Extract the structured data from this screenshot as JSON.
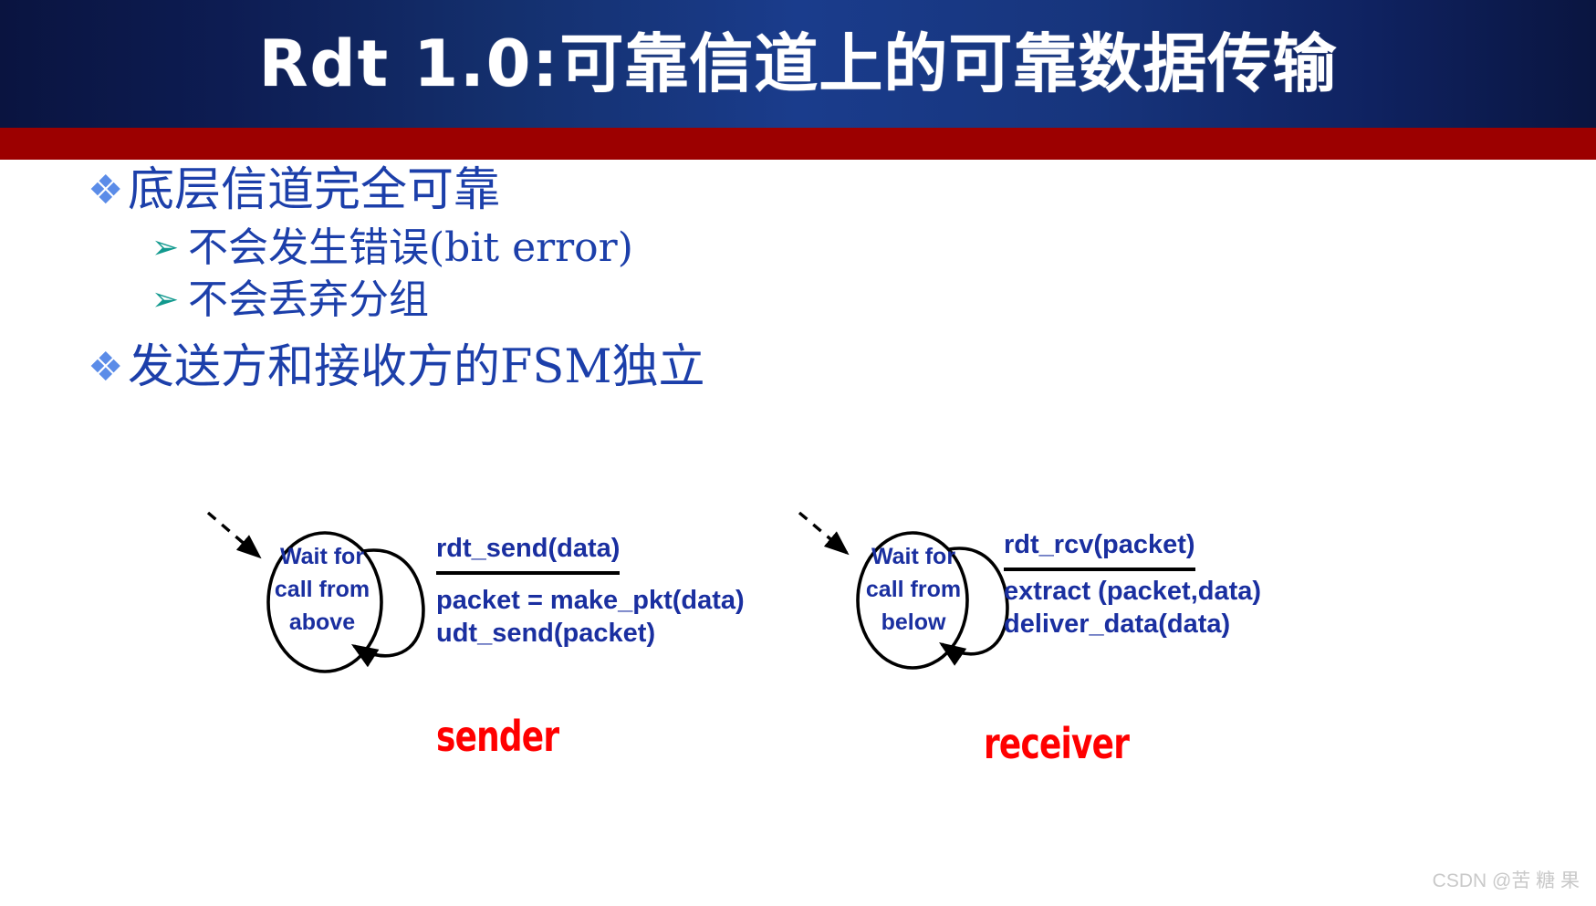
{
  "slide": {
    "title": {
      "latin": "Rdt 1.0:",
      "chinese": "可靠信道上的可靠数据传输",
      "full": "Rdt 1.0: 可靠信道上的可靠数据传输"
    },
    "colors": {
      "banner_navy": "#14306e",
      "banner_rule_red": "#9c0000",
      "bullet_text_blue": "#1c3faa",
      "bullet_marker_blue": "#5b8ce8",
      "sub_marker_teal": "#11998e",
      "fsm_text_blue": "#1a2fa0",
      "role_label_red": "#ff0000",
      "watermark_gray": "#c9c9c9"
    },
    "bullets": [
      {
        "marker": "❖",
        "label": "底层信道完全可靠",
        "level": 1
      },
      {
        "marker": "➢",
        "label": "不会发生错误(bit error)",
        "level": 2
      },
      {
        "marker": "➢",
        "label": "不会丢弃分组",
        "level": 2
      },
      {
        "marker": "❖",
        "label": "发送方和接收方的FSM独立",
        "level": 1
      }
    ],
    "fsm": {
      "sender": {
        "role_label": "sender",
        "state_lines": [
          "Wait for",
          "call from",
          "above"
        ],
        "transition_event": "rdt_send(data)",
        "transition_actions": [
          "packet = make_pkt(data)",
          "udt_send(packet)"
        ]
      },
      "receiver": {
        "role_label": "receiver",
        "state_lines": [
          "Wait for",
          "call from",
          "below"
        ],
        "transition_event": "rdt_rcv(packet)",
        "transition_actions": [
          "extract (packet,data)",
          "deliver_data(data)"
        ]
      }
    },
    "watermark": "CSDN @苦 糖 果"
  }
}
